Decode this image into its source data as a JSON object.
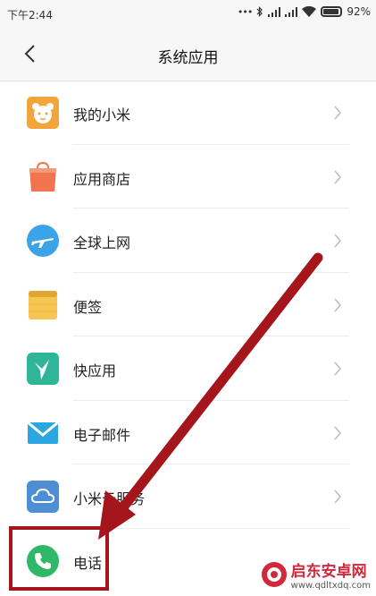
{
  "status_bar": {
    "time": "下午2:44",
    "battery": "92%",
    "icons": [
      "dots-icon",
      "bluetooth-icon",
      "signal-icon",
      "signal-icon",
      "wifi-icon",
      "battery-icon"
    ]
  },
  "header": {
    "title": "系统应用",
    "back_icon": "back-arrow-icon"
  },
  "apps": [
    {
      "label": "我的小米",
      "icon": "mi-account-icon",
      "color": "#f2a53a"
    },
    {
      "label": "应用商店",
      "icon": "app-store-icon",
      "color": "#f0754e"
    },
    {
      "label": "全球上网",
      "icon": "global-internet-icon",
      "color": "#3ba4e8"
    },
    {
      "label": "便签",
      "icon": "notes-icon",
      "color": "#f5c652"
    },
    {
      "label": "快应用",
      "icon": "quick-apps-icon",
      "color": "#2fb597"
    },
    {
      "label": "电子邮件",
      "icon": "email-icon",
      "color": "#2ca6e0"
    },
    {
      "label": "小米云服务",
      "icon": "mi-cloud-icon",
      "color": "#4d8ed4"
    },
    {
      "label": "电话",
      "icon": "phone-icon",
      "color": "#2eb867"
    }
  ],
  "annotation": {
    "color": "#a5161c"
  },
  "watermark": {
    "name": "启东安卓网",
    "url": "www.qdltxdq.com"
  }
}
